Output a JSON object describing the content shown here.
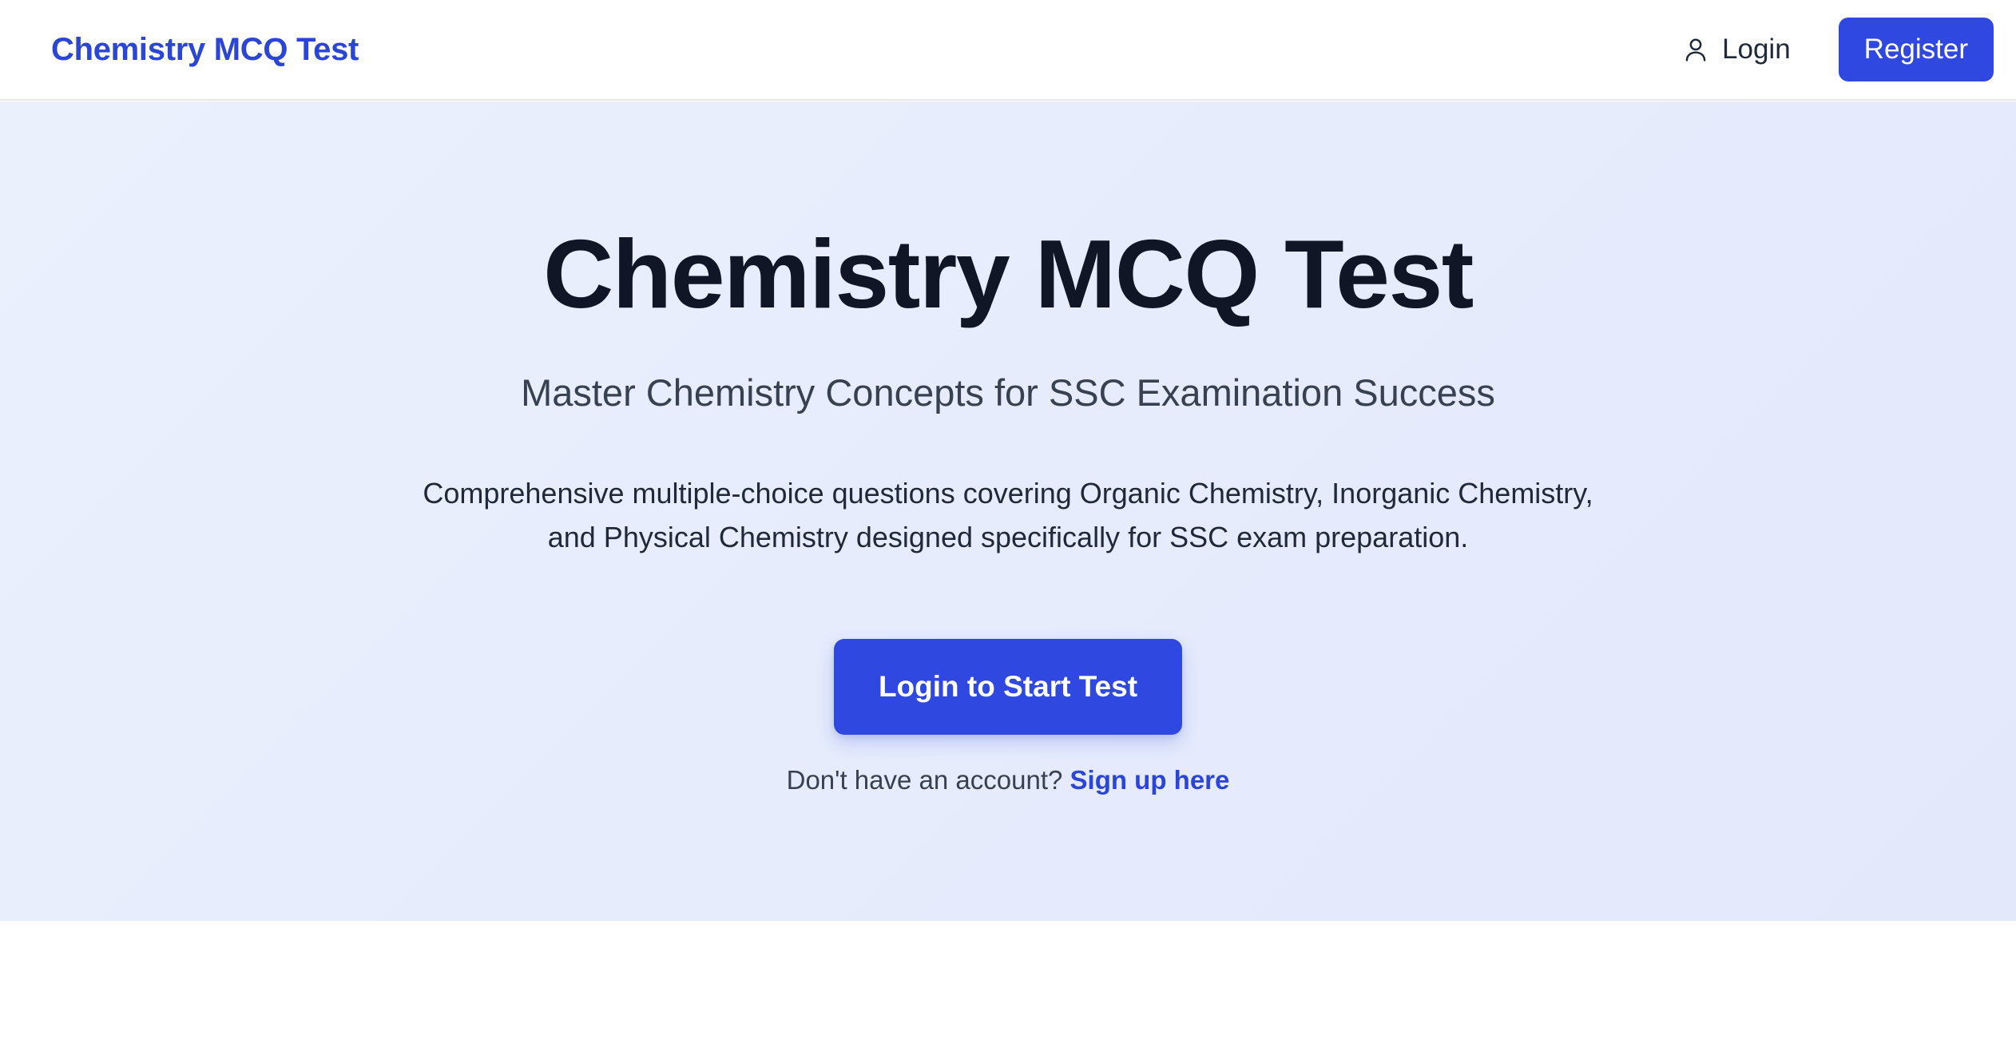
{
  "navbar": {
    "brand": "Chemistry MCQ Test",
    "login_label": "Login",
    "login_icon": "user-icon",
    "register_label": "Register"
  },
  "hero": {
    "title": "Chemistry MCQ Test",
    "subtitle": "Master Chemistry Concepts for SSC Examination Success",
    "description": "Comprehensive multiple-choice questions covering Organic Chemistry, Inorganic Chemistry, and Physical Chemistry designed specifically for SSC exam preparation.",
    "cta_label": "Login to Start Test",
    "signup_prompt": "Don't have an account?",
    "signup_link": "Sign up here"
  },
  "colors": {
    "accent": "#2f48e0",
    "brand_text": "#2b46d4",
    "hero_background": "#e6ecfc",
    "title_text": "#101626"
  }
}
